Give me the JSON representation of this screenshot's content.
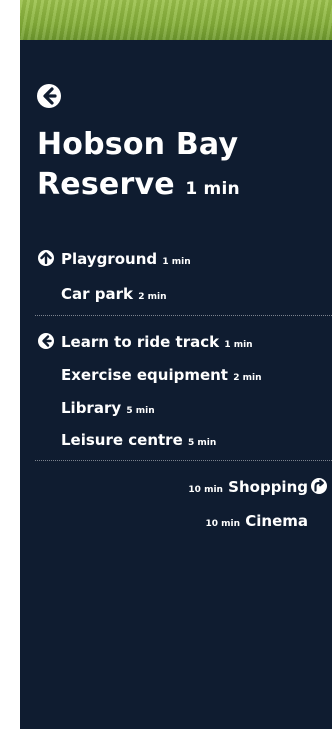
{
  "header": {
    "back_icon": "left-arrow-circle-icon",
    "title_line1": "Hobson Bay",
    "title_line2": "Reserve",
    "title_time": "1 min"
  },
  "section1": {
    "icon": "up-arrow-circle-icon",
    "items": [
      {
        "label": "Playground",
        "time": "1 min"
      },
      {
        "label": "Car park",
        "time": "2 min"
      }
    ]
  },
  "section2": {
    "icon": "left-arrow-circle-icon",
    "items": [
      {
        "label": "Learn to ride track",
        "time": "1 min"
      },
      {
        "label": "Exercise equipment",
        "time": "2 min"
      },
      {
        "label": "Library",
        "time": "5 min"
      },
      {
        "label": "Leisure centre",
        "time": "5 min"
      }
    ]
  },
  "section3": {
    "icon": "right-curve-arrow-circle-icon",
    "items": [
      {
        "label": "Shopping",
        "time": "10 min"
      },
      {
        "label": "Cinema",
        "time": "10 min"
      }
    ]
  },
  "colors": {
    "sign_background": "#0f1c30",
    "text": "#ffffff",
    "grass": "#8ab63e"
  }
}
